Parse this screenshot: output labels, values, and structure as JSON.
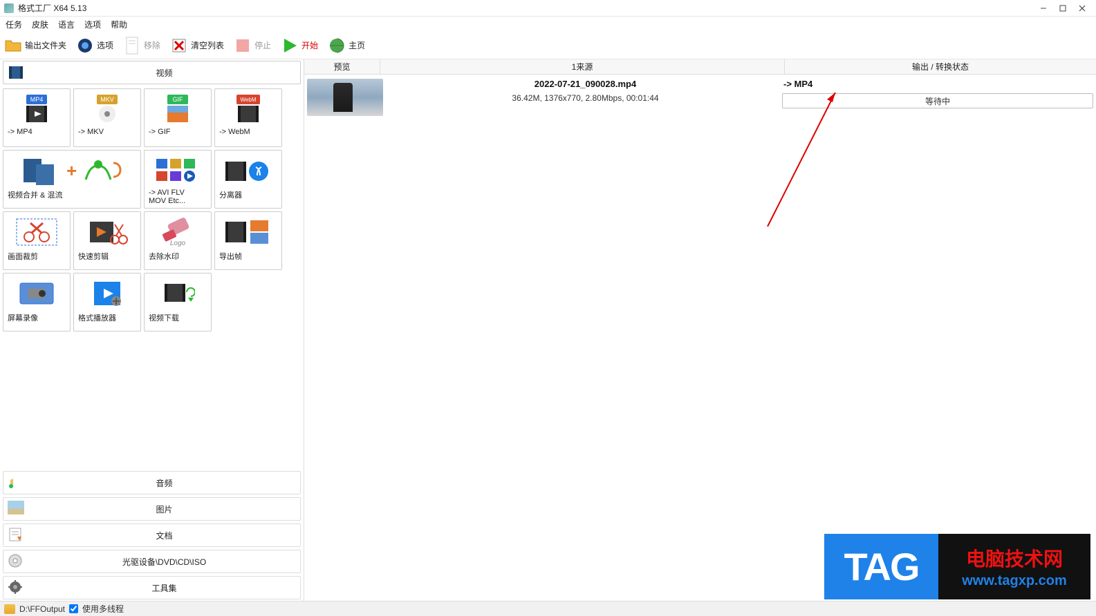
{
  "title": "格式工厂 X64 5.13",
  "menu": [
    "任务",
    "皮肤",
    "语言",
    "选项",
    "帮助"
  ],
  "toolbar": {
    "output_folder": "输出文件夹",
    "options": "选项",
    "remove": "移除",
    "clear_list": "清空列表",
    "stop": "停止",
    "start": "开始",
    "homepage": "主页"
  },
  "categories": {
    "video": "视频",
    "audio": "音频",
    "image": "图片",
    "document": "文档",
    "disc": "光驱设备\\DVD\\CD\\ISO",
    "tools": "工具集"
  },
  "video_tiles": [
    {
      "label": "-> MP4"
    },
    {
      "label": "-> MKV"
    },
    {
      "label": "-> GIF"
    },
    {
      "label": "-> WebM"
    },
    {
      "label": "视频合并 & 混流"
    },
    {
      "label": "-> AVI FLV\nMOV Etc..."
    },
    {
      "label": "分离器"
    },
    {
      "label": "画面裁剪"
    },
    {
      "label": "快速剪辑"
    },
    {
      "label": "去除水印"
    },
    {
      "label": "导出帧"
    },
    {
      "label": "屏幕录像"
    },
    {
      "label": "格式播放器"
    },
    {
      "label": "视频下载"
    }
  ],
  "list_header": {
    "preview": "预览",
    "source_prefix": "1 ",
    "source": "来源",
    "status": "输出 / 转换状态"
  },
  "task": {
    "filename": "2022-07-21_090028.mp4",
    "meta": "36.42M, 1376x770, 2.80Mbps, 00:01:44",
    "target": "-> MP4",
    "progress_text": "等待中"
  },
  "statusbar": {
    "output_path": "D:\\FFOutput",
    "multithread": "使用多线程"
  },
  "watermark": {
    "tag": "TAG",
    "line1": "电脑技术网",
    "line2": "www.tagxp.com"
  }
}
